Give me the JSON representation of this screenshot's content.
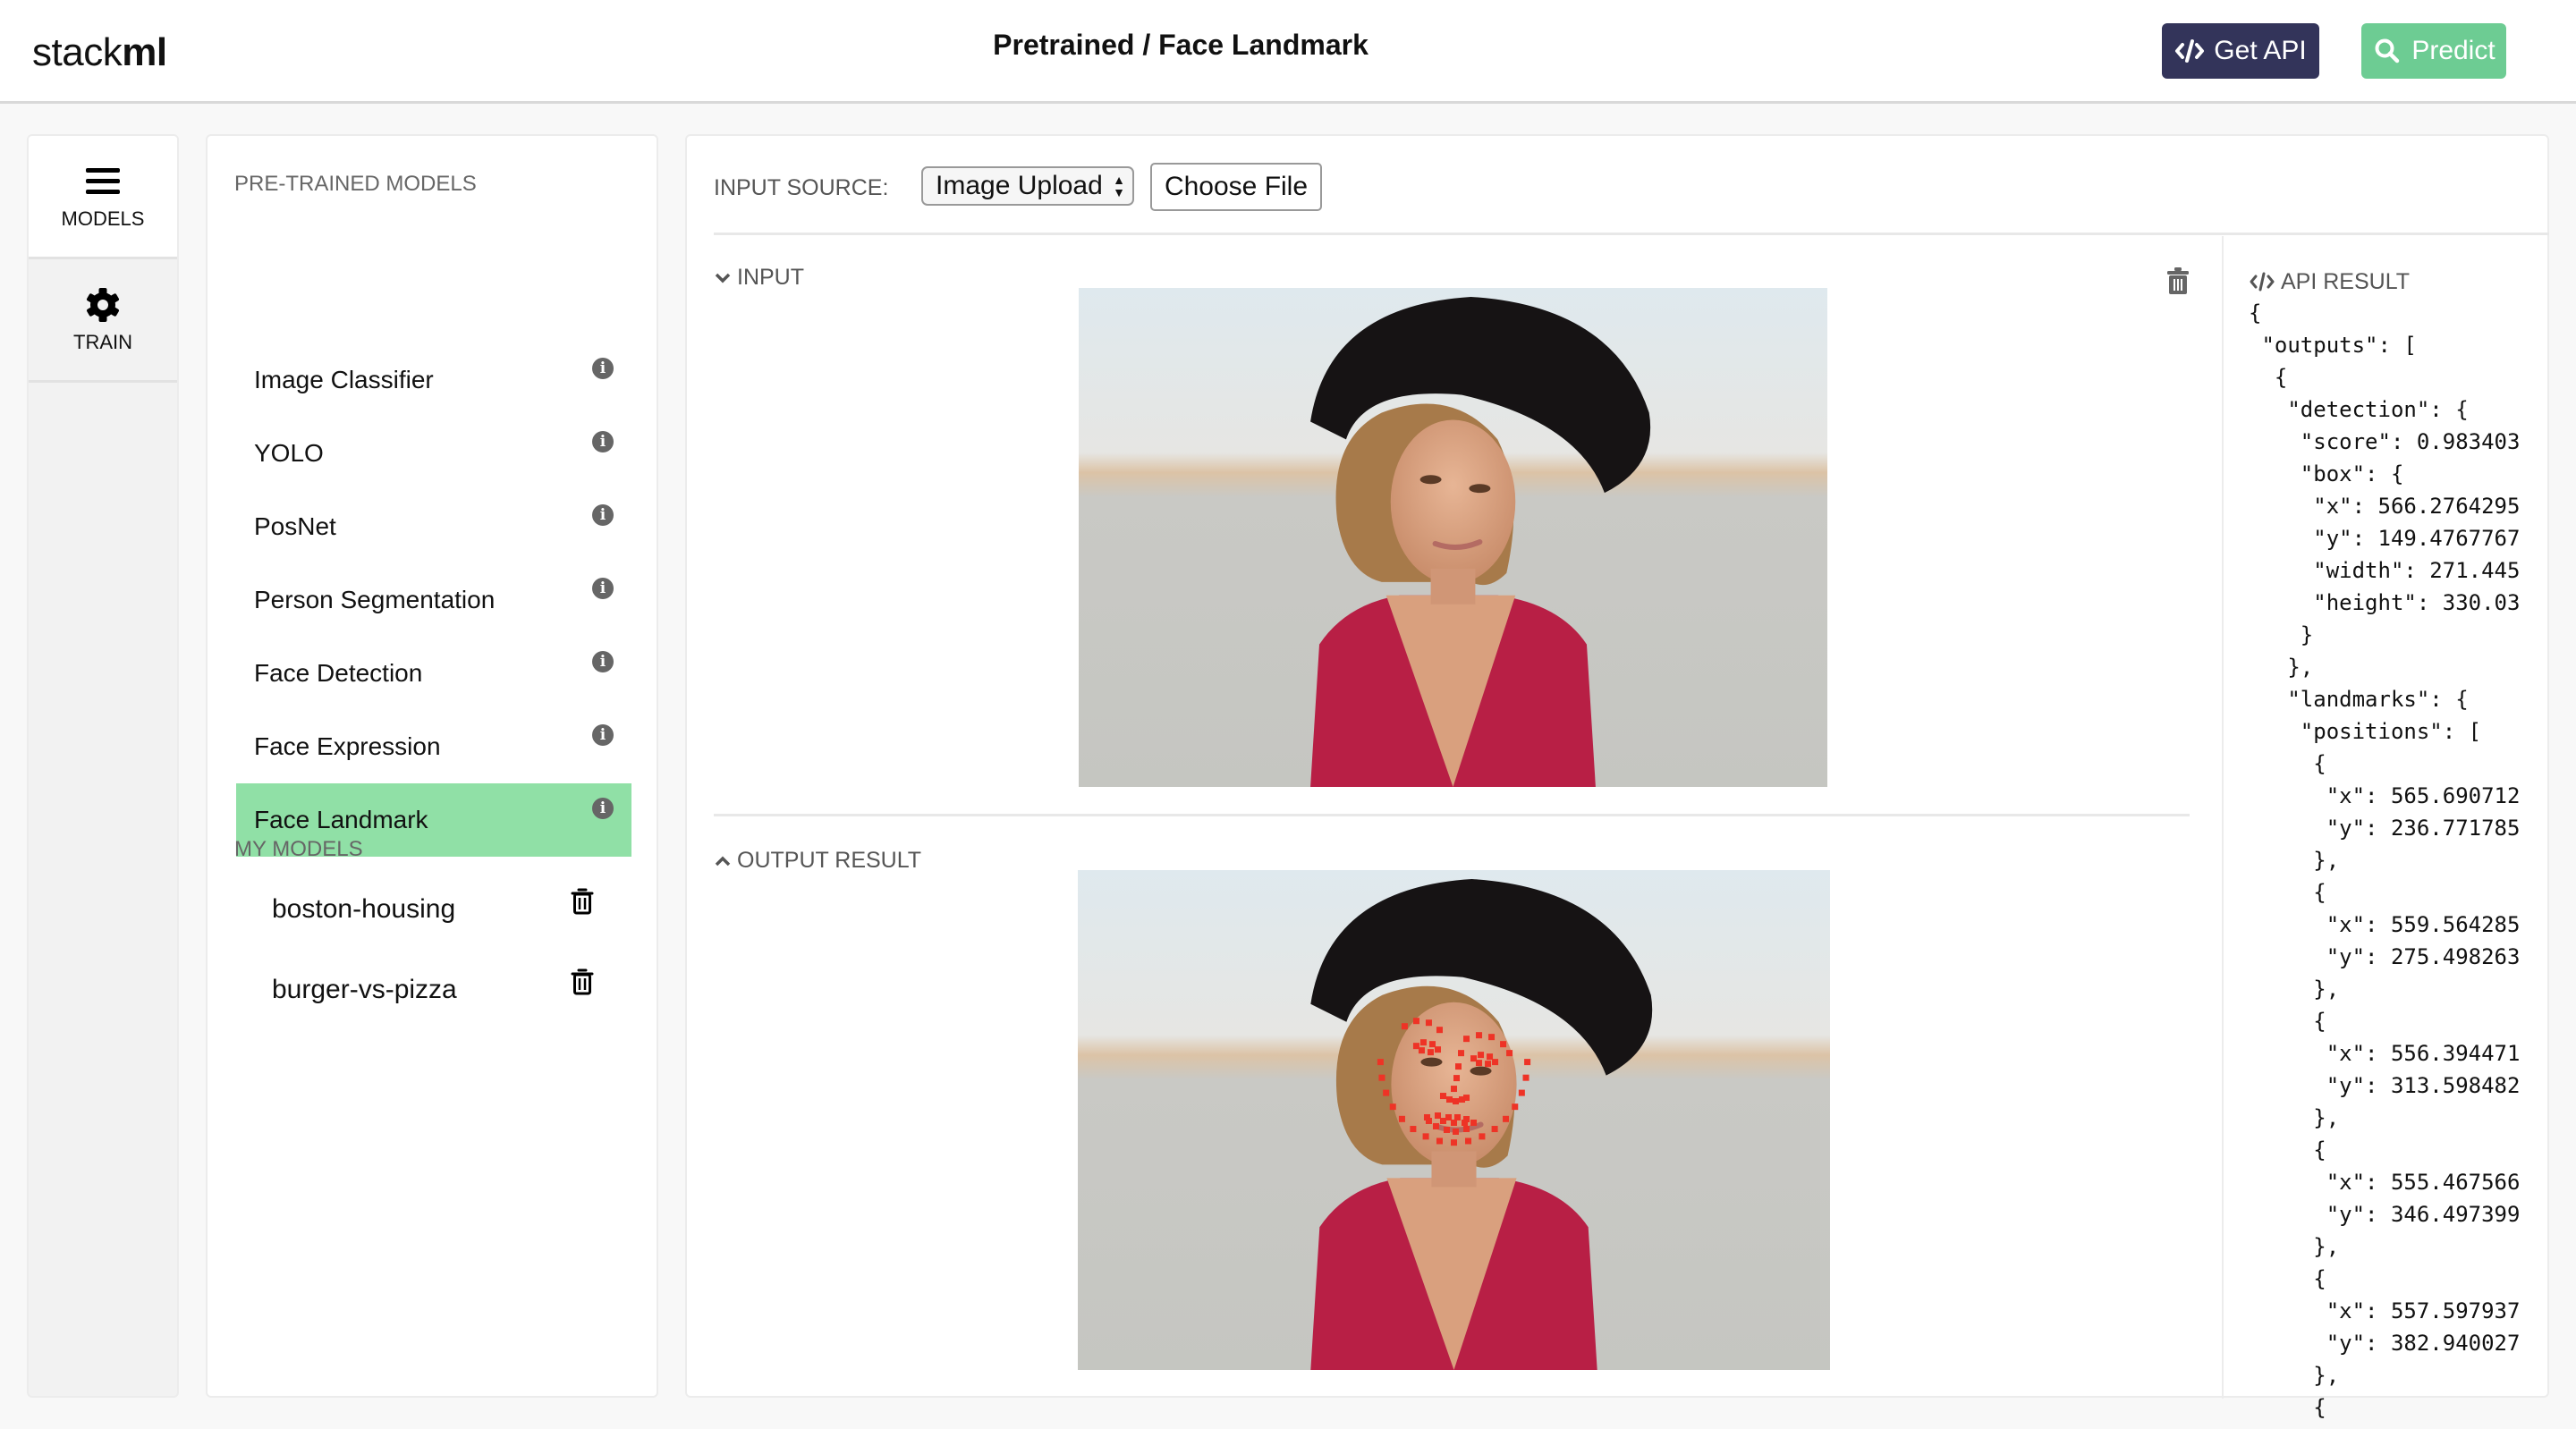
{
  "header": {
    "logo_light": "stack",
    "logo_bold": "ml",
    "title": "Pretrained / Face Landmark",
    "get_api_label": "Get API",
    "predict_label": "Predict",
    "colors": {
      "get_api": "#33345a",
      "predict": "#6dcc93",
      "selected_model": "#90e0a6"
    }
  },
  "nav": {
    "items": [
      {
        "label": "MODELS",
        "icon": "hamburger-icon",
        "active": true
      },
      {
        "label": "TRAIN",
        "icon": "gear-icon",
        "active": false
      }
    ]
  },
  "models": {
    "pretrained_heading": "PRE-TRAINED MODELS",
    "pretrained": [
      {
        "label": "Image Classifier"
      },
      {
        "label": "YOLO"
      },
      {
        "label": "PosNet"
      },
      {
        "label": "Person Segmentation"
      },
      {
        "label": "Face Detection"
      },
      {
        "label": "Face Expression"
      },
      {
        "label": "Face Landmark",
        "selected": true
      }
    ],
    "my_heading": "MY MODELS",
    "mine": [
      {
        "label": "boston-housing"
      },
      {
        "label": "burger-vs-pizza"
      }
    ]
  },
  "main": {
    "input_source_label": "INPUT SOURCE:",
    "input_source_value": "Image Upload",
    "choose_file_label": "Choose File",
    "input_section": "INPUT",
    "output_section": "OUTPUT RESULT",
    "api_result_title": "API RESULT",
    "api_result_lines": [
      "{",
      " \"outputs\": [",
      "  {",
      "   \"detection\": {",
      "    \"score\": 0.983403",
      "    \"box\": {",
      "     \"x\": 566.2764295",
      "     \"y\": 149.4767767",
      "     \"width\": 271.445",
      "     \"height\": 330.03",
      "    }",
      "   },",
      "   \"landmarks\": {",
      "    \"positions\": [",
      "     {",
      "      \"x\": 565.690712",
      "      \"y\": 236.771785",
      "     },",
      "     {",
      "      \"x\": 559.564285",
      "      \"y\": 275.498263",
      "     },",
      "     {",
      "      \"x\": 556.394471",
      "      \"y\": 313.598482",
      "     },",
      "     {",
      "      \"x\": 555.467566",
      "      \"y\": 346.497399",
      "     },",
      "     {",
      "      \"x\": 557.597937",
      "      \"y\": 382.940027",
      "     },",
      "     {"
    ]
  }
}
